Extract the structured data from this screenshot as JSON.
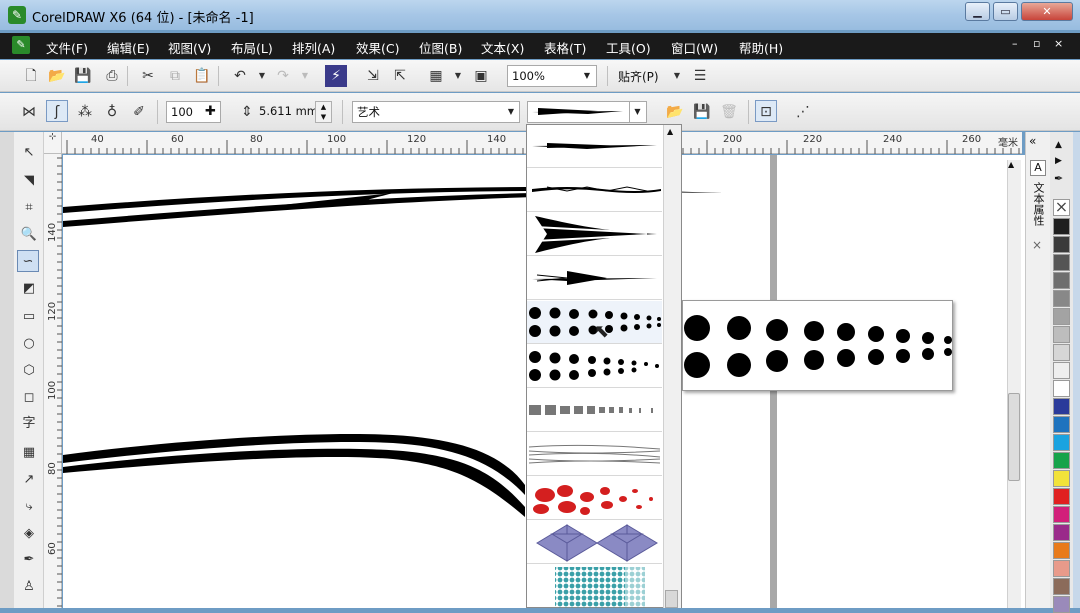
{
  "window": {
    "title": "CorelDRAW X6 (64 位) - [未命名 -1]",
    "logo": "Coreldraw-logo"
  },
  "menu": [
    "文件(F)",
    "编辑(E)",
    "视图(V)",
    "布局(L)",
    "排列(A)",
    "效果(C)",
    "位图(B)",
    "文本(X)",
    "表格(T)",
    "工具(O)",
    "窗口(W)",
    "帮助(H)"
  ],
  "standard_toolbar": {
    "zoom": "100%",
    "snap_label": "贴齐(P)"
  },
  "property_bar": {
    "smoothing": "100",
    "width": "5.611 mm",
    "preset": "艺术"
  },
  "rulers": {
    "h_labels": [
      "40",
      "60",
      "80",
      "100",
      "120",
      "140",
      "200",
      "220",
      "240",
      "260",
      "毫米"
    ],
    "v_labels": [
      "140",
      "120",
      "100",
      "80",
      "60"
    ]
  },
  "docker": {
    "tab_label": "文本属性"
  },
  "palette_colors": [
    "#1e1e1e",
    "#3a3a3a",
    "#555555",
    "#6e6e6e",
    "#888888",
    "#a3a3a3",
    "#bdbdbd",
    "#d6d6d6",
    "#eeeeee",
    "#ffffff",
    "#2a3a9a",
    "#1e73be",
    "#1aa3e0",
    "#16a34a",
    "#f2e23a",
    "#e02020",
    "#d21f7a",
    "#9a2a8a",
    "#e87a1a",
    "#e89a8a",
    "#8b6b5a",
    "#9a8aba"
  ]
}
